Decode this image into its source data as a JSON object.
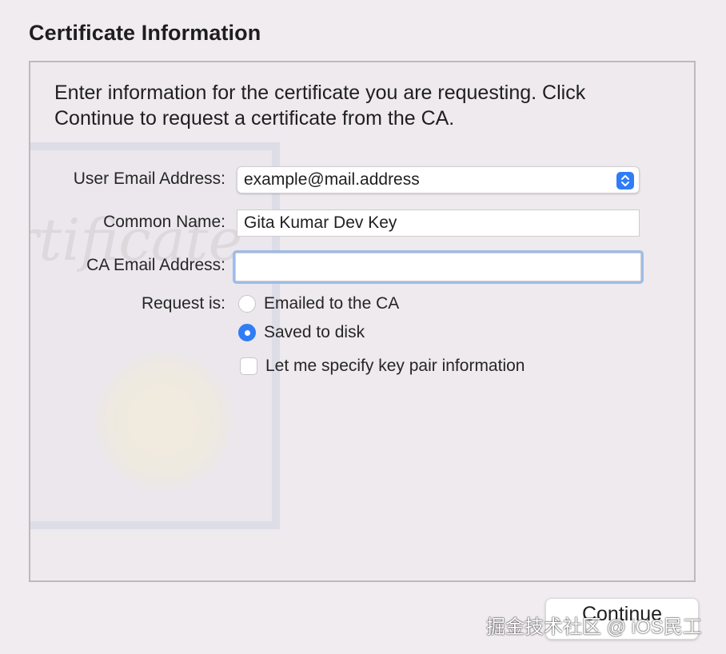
{
  "window": {
    "title": "Certificate Information"
  },
  "intro_text": "Enter information for the certificate you are requesting. Click Continue to request a certificate from the CA.",
  "form": {
    "user_email_label": "User Email Address:",
    "user_email_value": "example@mail.address",
    "common_name_label": "Common Name:",
    "common_name_value": "Gita Kumar Dev Key",
    "ca_email_label": "CA Email Address:",
    "ca_email_value": "",
    "request_label": "Request is:",
    "request_options": [
      {
        "label": "Emailed to the CA",
        "selected": false
      },
      {
        "label": "Saved to disk",
        "selected": true
      }
    ],
    "key_pair_label": "Let me specify key pair information",
    "key_pair_checked": false
  },
  "buttons": {
    "continue_label": "Continue"
  },
  "overlay_credit": "掘金技术社区 @ iOS民工",
  "colors": {
    "accent": "#2f7df6",
    "focus_ring": "#9fbcea",
    "window_bg": "#f1ecf0"
  },
  "icons": {
    "popup": "chevron-updown-icon",
    "radio_on": "radio-selected-icon",
    "radio_off": "radio-unselected-icon",
    "checkbox": "checkbox-unchecked-icon"
  }
}
